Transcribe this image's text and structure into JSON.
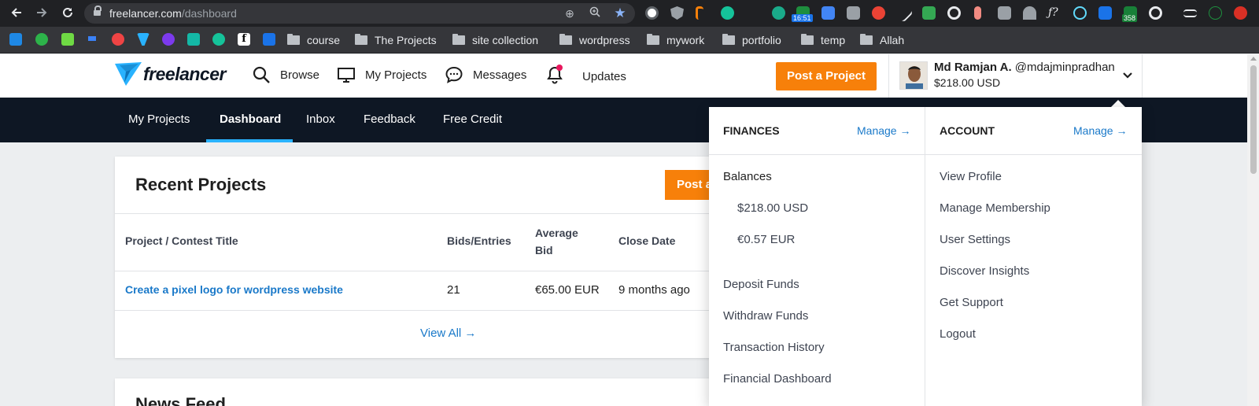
{
  "browser": {
    "url_domain": "freelancer.com",
    "url_path": "/dashboard",
    "clock_badge": "16:51",
    "count_badge": "358",
    "bookmark_folders": [
      "course",
      "The Projects",
      "site collection",
      "wordpress",
      "mywork",
      "portfolio",
      "temp",
      "Allah"
    ]
  },
  "header": {
    "logo_text": "freelancer",
    "nav": [
      "Browse",
      "My Projects",
      "Messages",
      "Updates"
    ],
    "post_project": "Post a Project",
    "user_name": "Md Ramjan A.",
    "user_handle": "@mdajminpradhan",
    "user_balance": "$218.00 USD"
  },
  "subnav": {
    "items": [
      "My Projects",
      "Dashboard",
      "Inbox",
      "Feedback",
      "Free Credit"
    ],
    "active": "Dashboard"
  },
  "recent_projects": {
    "title": "Recent Projects",
    "post_button": "Post a",
    "columns": [
      "Project / Contest Title",
      "Bids/Entries",
      "Average",
      "Bid",
      "Close Date"
    ],
    "rows": [
      {
        "title": "Create a pixel logo for wordpress website",
        "bids": "21",
        "avg_bid": "€65.00 EUR",
        "close": "9 months ago"
      }
    ],
    "view_all": "View All →"
  },
  "news_feed": {
    "title": "News Feed"
  },
  "dropdown": {
    "finances": {
      "heading": "FINANCES",
      "manage": "Manage →",
      "balances_label": "Balances",
      "balances": [
        "$218.00 USD",
        "€0.57 EUR"
      ],
      "items": [
        "Deposit Funds",
        "Withdraw Funds",
        "Transaction History",
        "Financial Dashboard"
      ]
    },
    "account": {
      "heading": "ACCOUNT",
      "manage": "Manage →",
      "items": [
        "View Profile",
        "Manage Membership",
        "User Settings",
        "Discover Insights",
        "Get Support",
        "Logout"
      ]
    }
  },
  "colors": {
    "brand_navy": "#0e1724",
    "accent_orange": "#f7800a",
    "link_blue": "#1a79c9",
    "active_underline": "#29b2fe"
  }
}
